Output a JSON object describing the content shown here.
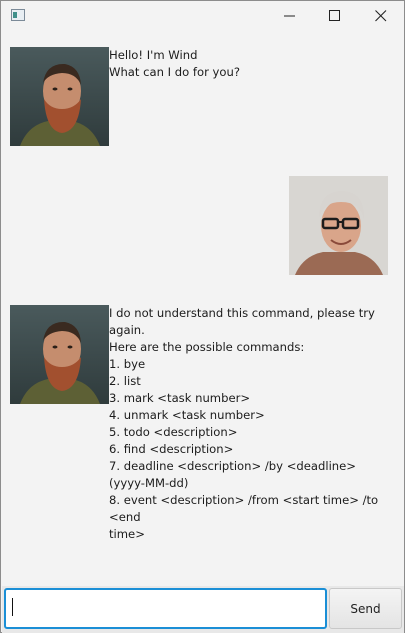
{
  "window": {
    "controls": {
      "minimize_icon": "minimize-icon",
      "maximize_icon": "maximize-icon",
      "close_icon": "close-icon"
    }
  },
  "chat": {
    "messages": [
      {
        "sender": "bot",
        "avatar_icon": "bot-avatar",
        "text": "Hello! I'm Wind\nWhat can I do for you?"
      },
      {
        "sender": "user",
        "avatar_icon": "user-avatar",
        "text": ""
      },
      {
        "sender": "bot",
        "avatar_icon": "bot-avatar",
        "text": "I do not understand this command, please try again.\nHere are the possible commands:\n1. bye\n2. list\n3. mark <task number>\n4. unmark <task number>\n5. todo <description>\n6. find <description>\n7. deadline <description> /by <deadline>\n(yyyy-MM-dd)\n8. event <description> /from <start time> /to <end\ntime>"
      }
    ]
  },
  "input": {
    "value": "",
    "placeholder": ""
  },
  "send_button": {
    "label": "Send"
  },
  "colors": {
    "input_focus_border": "#1b8fd6",
    "background": "#f3f3f3"
  }
}
